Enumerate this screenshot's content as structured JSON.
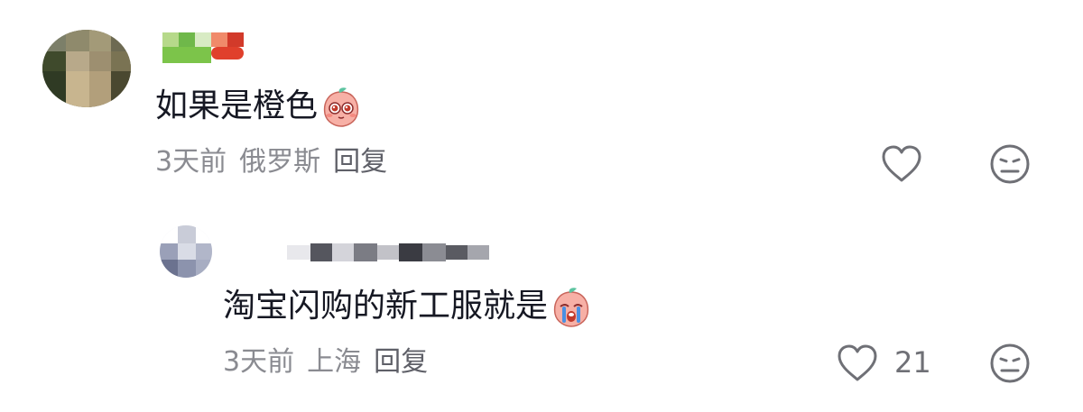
{
  "comments": [
    {
      "text": "如果是橙色",
      "emoji": "peach-emoji-hopeful",
      "meta": {
        "time": "3天前",
        "location": "俄罗斯",
        "reply": "回复"
      },
      "likes": "",
      "avatar": "blurred-avatar",
      "username": "blurred-username"
    },
    {
      "text": "淘宝闪购的新工服就是",
      "emoji": "peach-emoji-crying",
      "meta": {
        "time": "3天前",
        "location": "上海",
        "reply": "回复"
      },
      "likes": "21",
      "avatar": "blurred-avatar",
      "username": "blurred-username"
    }
  ],
  "icons": {
    "like": "heart-outline-icon",
    "dislike": "unamused-face-icon"
  },
  "colors": {
    "text": "#161823",
    "meta": "#8a8b91",
    "icon": "#6f7076",
    "emoji_body": "#f7a8a0",
    "emoji_leaf": "#5cc4a0"
  }
}
